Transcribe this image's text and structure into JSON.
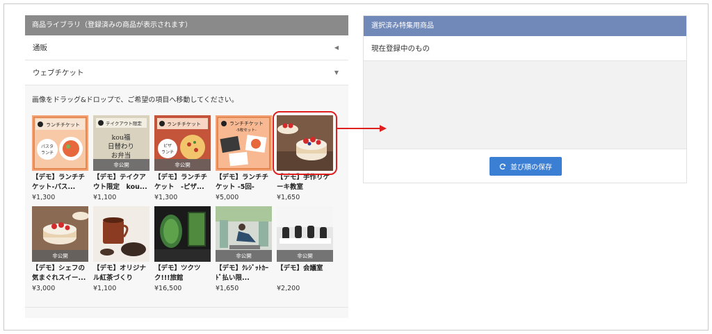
{
  "library": {
    "header": "商品ライブラリ（登録済みの商品が表示されます）",
    "sections": [
      {
        "label": "通販",
        "state": "collapsed"
      },
      {
        "label": "ウェブチケット",
        "state": "expanded"
      }
    ],
    "instruction": "画像をドラッグ&ドロップで、ご希望の項目へ移動してください。",
    "products": [
      {
        "title": "【デモ】ランチチケット-パス...",
        "price": "¥1,300",
        "badge": "",
        "thumb_text": "ランチチケット",
        "thumb_sub": "パスタランチ"
      },
      {
        "title": "【デモ】テイクアウト限定　kou...",
        "price": "¥1,100",
        "badge": "非公開",
        "thumb_text": "テイクアウト限定",
        "thumb_sub": "kou福\n日替わり\nお弁当"
      },
      {
        "title": "【デモ】ランチチケット　-ピザ...",
        "price": "¥1,300",
        "badge": "非公開",
        "thumb_text": "ランチチケット",
        "thumb_sub": "ピザランチ"
      },
      {
        "title": "【デモ】ランチチケット -5回-",
        "price": "¥5,000",
        "badge": "",
        "thumb_text": "ランチチケット",
        "thumb_sub": "-5枚セット-"
      },
      {
        "title": "【デモ】手作りケーキ教室",
        "price": "¥1,650",
        "badge": "",
        "thumb_text": "",
        "thumb_sub": ""
      },
      {
        "title": "【デモ】シェフの気まぐれスイー...",
        "price": "¥3,000",
        "badge": "非公開",
        "thumb_text": "",
        "thumb_sub": ""
      },
      {
        "title": "【デモ】オリジナル紅茶づくり",
        "price": "¥1,100",
        "badge": "",
        "thumb_text": "",
        "thumb_sub": ""
      },
      {
        "title": "【デモ】ツクツク!!!旅館",
        "price": "¥16,500",
        "badge": "",
        "thumb_text": "",
        "thumb_sub": ""
      },
      {
        "title": "【デモ】ｸﾚｼﾞｯﾄｶｰﾄﾞ払い限...",
        "price": "¥1,650",
        "badge": "非公開",
        "thumb_text": "",
        "thumb_sub": ""
      },
      {
        "title": "【デモ】会議室",
        "price": "¥2,200",
        "badge": "非公開",
        "thumb_text": "",
        "thumb_sub": ""
      }
    ]
  },
  "selected": {
    "header": "選択済み特集用商品",
    "subheader": "現在登録中のもの",
    "save_label": "並び順の保存",
    "save_icon": "refresh-icon"
  },
  "colors": {
    "library_header": "#8a8a8a",
    "selected_header": "#7189b9",
    "save_button": "#3b7fd4",
    "annotation": "#e01f1f"
  }
}
